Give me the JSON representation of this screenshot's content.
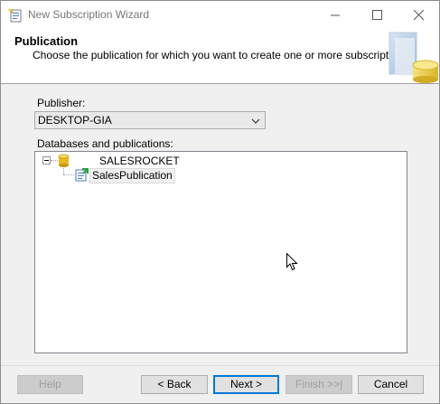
{
  "window": {
    "title": "New Subscription Wizard"
  },
  "header": {
    "title": "Publication",
    "subtitle": "Choose the publication for which you want to create one or more subscriptions."
  },
  "publisher": {
    "label": "Publisher:",
    "value": "DESKTOP-GIA"
  },
  "tree": {
    "label": "Databases and publications:",
    "database": "SALESROCKET",
    "publication": "SalesPublication"
  },
  "buttons": {
    "help": "Help",
    "back": "< Back",
    "next": "Next >",
    "finish": "Finish >>|",
    "cancel": "Cancel"
  },
  "colors": {
    "accent": "#0078d7",
    "database_icon": "#e8b820"
  }
}
